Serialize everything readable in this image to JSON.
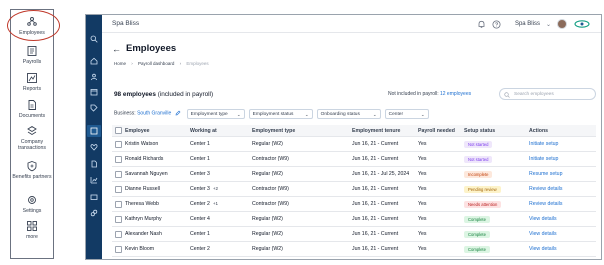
{
  "left_nav": {
    "items": [
      {
        "label": "Employees",
        "icon": "employees-icon"
      },
      {
        "label": "Payrolls",
        "icon": "payroll-icon"
      },
      {
        "label": "Reports",
        "icon": "reports-icon"
      },
      {
        "label": "Documents",
        "icon": "documents-icon"
      },
      {
        "label": "Company transactions",
        "icon": "transactions-icon"
      },
      {
        "label": "Benefits partners",
        "icon": "benefits-icon"
      },
      {
        "label": "Settings",
        "icon": "settings-icon"
      },
      {
        "label": "more",
        "icon": "grid-icon"
      }
    ]
  },
  "header": {
    "brand": "Spa Bliss",
    "company_select": "Spa Bliss",
    "chevron": "⌄"
  },
  "page": {
    "back_arrow": "←",
    "title": "Employees",
    "breadcrumb": [
      "Home",
      "›",
      "Payroll dashboard",
      "›",
      "Employees"
    ]
  },
  "summary": {
    "count_bold": "98 employees",
    "count_rest": " (included in payroll)",
    "not_included_label": "Not included in payroll: ",
    "not_included_link": "12 employees",
    "search_placeholder": "Search employees"
  },
  "filters": {
    "business_label": "Business: ",
    "business_value": "South Granville",
    "dropdowns": [
      "Employment type",
      "Employment status",
      "Onboarding status",
      "Center"
    ]
  },
  "table": {
    "headers": [
      "",
      "Employee",
      "Working at",
      "Employment type",
      "Employment tenure",
      "Payroll needed",
      "Setup status",
      "Actions"
    ],
    "rows": [
      {
        "name": "Kristin Watson",
        "center": "Center 1",
        "extra": "",
        "type": "Regular (W2)",
        "tenure": "Jun 16, 21 - Current",
        "payroll": "Yes",
        "status": "Not started",
        "status_color": "#7c3aed",
        "status_bg": "#efe7fb",
        "action": "Initiate setup"
      },
      {
        "name": "Ronald Richards",
        "center": "Center 1",
        "extra": "",
        "type": "Contractor (W9)",
        "tenure": "Jun 16, 21 - Current",
        "payroll": "Yes",
        "status": "Not started",
        "status_color": "#7c3aed",
        "status_bg": "#efe7fb",
        "action": "Initiate setup"
      },
      {
        "name": "Savannah Nguyen",
        "center": "Center 3",
        "extra": "",
        "type": "Regular (W2)",
        "tenure": "Jun 16, 21 - Jul 25, 2024",
        "payroll": "Yes",
        "status": "Incomplete",
        "status_color": "#c2410c",
        "status_bg": "#fde8dc",
        "action": "Resume setup"
      },
      {
        "name": "Dianne Russell",
        "center": "Center 3",
        "extra": "+2",
        "type": "Contractor (W9)",
        "tenure": "Jun 16, 21 - Current",
        "payroll": "Yes",
        "status": "Pending review",
        "status_color": "#a16207",
        "status_bg": "#fdf3c9",
        "action": "Review details"
      },
      {
        "name": "Theresa Webb",
        "center": "Center 2",
        "extra": "+1",
        "type": "Contractor (W9)",
        "tenure": "Jun 16, 21 - Current",
        "payroll": "Yes",
        "status": "Needs attention",
        "status_color": "#b91c1c",
        "status_bg": "#fde2e2",
        "action": "Review details"
      },
      {
        "name": "Kathryn Murphy",
        "center": "Center 4",
        "extra": "",
        "type": "Regular (W2)",
        "tenure": "Jun 16, 21 - Current",
        "payroll": "Yes",
        "status": "Complete",
        "status_color": "#15803d",
        "status_bg": "#dcf5e3",
        "action": "View details"
      },
      {
        "name": "Alexander Nash",
        "center": "Center 1",
        "extra": "",
        "type": "Regular (W2)",
        "tenure": "Jun 16, 21 - Current",
        "payroll": "Yes",
        "status": "Complete",
        "status_color": "#15803d",
        "status_bg": "#dcf5e3",
        "action": "View details"
      },
      {
        "name": "Kevin Bloom",
        "center": "Center 2",
        "extra": "",
        "type": "Regular (W2)",
        "tenure": "Jun 16, 21 - Current",
        "payroll": "Yes",
        "status": "Complete",
        "status_color": "#15803d",
        "status_bg": "#dcf5e3",
        "action": "View details"
      }
    ]
  },
  "colors": {
    "rail": "#123a64",
    "link": "#1d6fd0",
    "highlight": "#c0392b"
  }
}
